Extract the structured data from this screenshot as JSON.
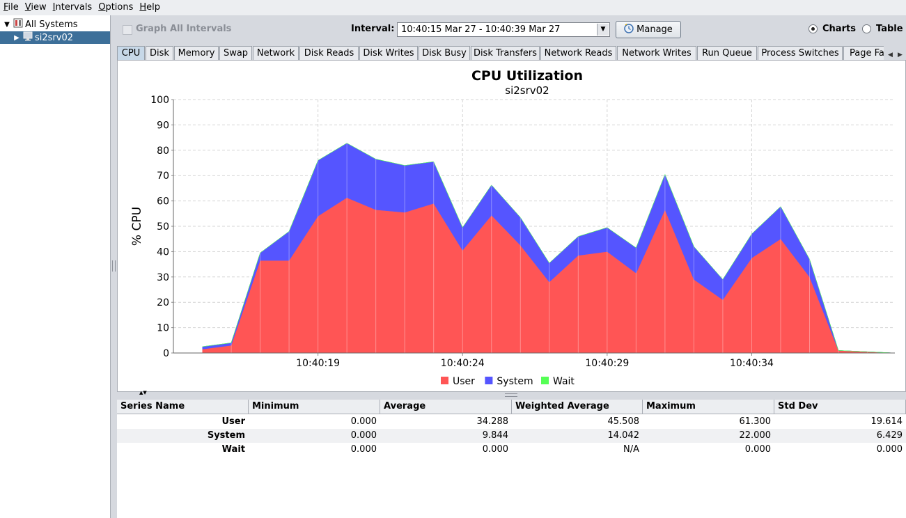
{
  "menu": [
    {
      "label": "File",
      "accel": "F"
    },
    {
      "label": "View",
      "accel": "V"
    },
    {
      "label": "Intervals",
      "accel": "I"
    },
    {
      "label": "Options",
      "accel": "O"
    },
    {
      "label": "Help",
      "accel": "H"
    }
  ],
  "tree": {
    "root_label": "All Systems",
    "child_label": "si2srv02"
  },
  "toolbar": {
    "graph_all_label": "Graph All Intervals",
    "interval_label": "Interval:",
    "interval_value": "10:40:15 Mar 27 - 10:40:39 Mar 27",
    "manage_label": "Manage",
    "charts_label": "Charts",
    "table_label": "Table",
    "view_mode": "Charts"
  },
  "tabs": [
    "CPU",
    "Disk",
    "Memory",
    "Swap",
    "Network",
    "Disk Reads",
    "Disk Writes",
    "Disk Busy",
    "Disk Transfers",
    "Network Reads",
    "Network Writes",
    "Run Queue",
    "Process Switches",
    "Page Fa"
  ],
  "active_tab": "CPU",
  "chart_data": {
    "type": "area",
    "stacked": true,
    "title": "CPU Utilization",
    "subtitle": "si2srv02",
    "ylabel": "% CPU",
    "xlabel": "",
    "ylim": [
      0,
      100
    ],
    "yticks": [
      0,
      10,
      20,
      30,
      40,
      50,
      60,
      70,
      80,
      90,
      100
    ],
    "x_tick_labels": [
      {
        "t": 19,
        "label": "10:40:19"
      },
      {
        "t": 24,
        "label": "10:40:24"
      },
      {
        "t": 29,
        "label": "10:40:29"
      },
      {
        "t": 34,
        "label": "10:40:34"
      }
    ],
    "xlim": [
      14.0,
      38.95
    ],
    "x": [
      15,
      16,
      17,
      18,
      19,
      20,
      21,
      22,
      23,
      24,
      25,
      26,
      27,
      28,
      29,
      30,
      31,
      32,
      33,
      34,
      35,
      36,
      37,
      38,
      38.95
    ],
    "series": [
      {
        "name": "User",
        "color": "#ff5555",
        "values": [
          1.5,
          3,
          36.5,
          36.5,
          54,
          61.3,
          56.5,
          55.5,
          59,
          40.5,
          54.3,
          42.5,
          28,
          38.5,
          40,
          31.5,
          56.5,
          29,
          21,
          37.5,
          45,
          30,
          1,
          0.5,
          0
        ]
      },
      {
        "name": "System",
        "color": "#5555ff",
        "values": [
          1,
          1,
          3,
          11.5,
          22,
          21.5,
          20,
          18.5,
          16.5,
          9,
          12,
          11,
          7.5,
          7.5,
          9.5,
          10,
          14,
          13,
          8,
          9.5,
          12.8,
          7,
          0,
          0,
          0
        ]
      },
      {
        "name": "Wait",
        "color": "#55ff55",
        "values": [
          0,
          0,
          0,
          0,
          0,
          0,
          0,
          0,
          0,
          0,
          0,
          0,
          0,
          0,
          0,
          0,
          0,
          0,
          0,
          0,
          0,
          0,
          0,
          0,
          0
        ]
      }
    ],
    "legend_position": "bottom",
    "grid": true
  },
  "stats": {
    "columns": [
      "Series Name",
      "Minimum",
      "Average",
      "Weighted Average",
      "Maximum",
      "Std Dev"
    ],
    "rows": [
      [
        "User",
        "0.000",
        "34.288",
        "45.508",
        "61.300",
        "19.614"
      ],
      [
        "System",
        "0.000",
        "9.844",
        "14.042",
        "22.000",
        "6.429"
      ],
      [
        "Wait",
        "0.000",
        "0.000",
        "N/A",
        "0.000",
        "0.000"
      ]
    ]
  }
}
